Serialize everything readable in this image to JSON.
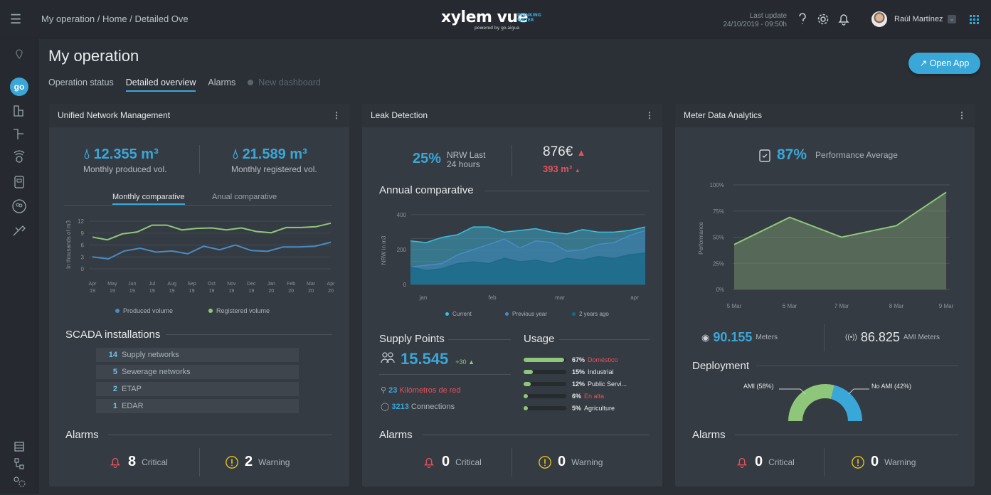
{
  "header": {
    "breadcrumb": "My operation / Home / Detailed Ove",
    "logo_main": "xylem vue",
    "logo_powered": "powered by go.aigua",
    "logo_tag1": "DRINKING",
    "logo_tag2": "WATER",
    "last_update_label": "Last update",
    "last_update_value": "24/10/2019 - 09:50h",
    "user_name": "Raúl Martínez"
  },
  "page": {
    "title": "My operation",
    "tabs": [
      "Operation status",
      "Detailed overview",
      "Alarms",
      "New dashboard"
    ],
    "open_app": "Open App"
  },
  "unm": {
    "title": "Unified Network Management",
    "produced_value": "12.355 m³",
    "produced_label": "Monthly produced vol.",
    "registered_value": "21.589 m³",
    "registered_label": "Monthly registered vol.",
    "tab_monthly": "Monthly comparative",
    "tab_annual": "Anual comparative",
    "ylabel": "In thousands of m3",
    "legend_produced": "Produced volume",
    "legend_registered": "Registered volume",
    "scada_title": "SCADA installations",
    "scada": [
      {
        "count": "14",
        "label": "Supply networks"
      },
      {
        "count": "5",
        "label": "Sewerage networks"
      },
      {
        "count": "2",
        "label": "ETAP"
      },
      {
        "count": "1",
        "label": "EDAR"
      }
    ],
    "alarms_title": "Alarms",
    "critical_count": "8",
    "critical_label": "Critical",
    "warning_count": "2",
    "warning_label": "Warning"
  },
  "leak": {
    "title": "Leak Detection",
    "nrw_pct": "25%",
    "nrw_label1": "NRW Last",
    "nrw_label2": "24 hours",
    "cost": "876€",
    "volume": "393 m³",
    "annual_title": "Annual comparative",
    "ylabel": "NRW in m3",
    "legend_current": "Current",
    "legend_prev": "Previous year",
    "legend_2y": "2 years ago",
    "supply_title": "Supply Points",
    "supply_value": "15.545",
    "supply_delta": "+30",
    "km_value": "23",
    "km_label": "Kilómetros de red",
    "conn_value": "3213",
    "conn_label": "Connections",
    "usage_title": "Usage",
    "usage": [
      {
        "pct": "67%",
        "label": "Doméstico",
        "fill": 0.67,
        "red": true
      },
      {
        "pct": "15%",
        "label": "Industrial",
        "fill": 0.15,
        "red": false
      },
      {
        "pct": "12%",
        "label": "Public Servi...",
        "fill": 0.12,
        "red": false
      },
      {
        "pct": "6%",
        "label": "En alta",
        "fill": 0.06,
        "red": true
      },
      {
        "pct": "5%",
        "label": "Agriculture",
        "fill": 0.05,
        "red": false
      }
    ],
    "alarms_title": "Alarms",
    "critical_count": "0",
    "critical_label": "Critical",
    "warning_count": "0",
    "warning_label": "Warning"
  },
  "mda": {
    "title": "Meter Data Analytics",
    "perf_value": "87%",
    "perf_label": "Performance Average",
    "ylabel": "Performance",
    "meters_value": "90.155",
    "meters_label": "Meters",
    "ami_value": "86.825",
    "ami_label": "AMI Meters",
    "deploy_title": "Deployment",
    "ami_pct_label": "AMI (58%)",
    "noami_pct_label": "No AMI (42%)",
    "ami_fraction": 0.58,
    "alarms_title": "Alarms",
    "critical_count": "0",
    "critical_label": "Critical",
    "warning_count": "0",
    "warning_label": "Warning"
  },
  "colors": {
    "accent": "#3aa7d9",
    "green": "#8fc77a",
    "blue": "#4a8bc4",
    "red": "#e8505b",
    "yellow": "#e8c21a"
  },
  "chart_data": [
    {
      "type": "line",
      "x": [
        "Apr 19",
        "May 19",
        "Jun 19",
        "Jul 19",
        "Aug 19",
        "Sep 19",
        "Oct 19",
        "Nov 19",
        "Dec 19",
        "Jan 20",
        "Feb 20",
        "Mar 20",
        "Apr 20"
      ],
      "series": [
        {
          "name": "Produced volume",
          "values": [
            3,
            2.5,
            4.5,
            5.2,
            4.2,
            4.5,
            3.8,
            5.7,
            4.8,
            6,
            4.6,
            4.4,
            5.5,
            5.5,
            5.7,
            6.7
          ]
        },
        {
          "name": "Registered volume",
          "values": [
            8,
            7.3,
            8.8,
            9.3,
            11,
            11,
            9.8,
            10.2,
            10.3,
            9.8,
            10.3,
            9.4,
            9.1,
            10.4,
            10.4,
            10.6,
            11.5
          ]
        }
      ],
      "ylabel": "In thousands of m3",
      "yticks": [
        0,
        3,
        6,
        9,
        12
      ],
      "ylim": [
        0,
        12
      ]
    },
    {
      "type": "area",
      "x": [
        "jan",
        "feb",
        "mar",
        "apr"
      ],
      "series": [
        {
          "name": "Current",
          "values": [
            250,
            240,
            270,
            285,
            330,
            330,
            300,
            310,
            320,
            300,
            290,
            315,
            300,
            300,
            310,
            330
          ]
        },
        {
          "name": "Previous year",
          "values": [
            100,
            110,
            120,
            170,
            200,
            230,
            260,
            210,
            250,
            240,
            190,
            200,
            230,
            240,
            280,
            310
          ]
        },
        {
          "name": "2 years ago",
          "values": [
            100,
            80,
            90,
            120,
            130,
            120,
            150,
            130,
            140,
            120,
            150,
            140,
            160,
            150,
            170,
            180
          ]
        }
      ],
      "ylabel": "NRW in m3",
      "yticks": [
        0,
        200,
        400
      ],
      "ylim": [
        0,
        420
      ]
    },
    {
      "type": "area",
      "x": [
        "5 Mar",
        "6 Mar",
        "7 Mar",
        "8 Mar",
        "9 Mar"
      ],
      "series": [
        {
          "values": [
            43,
            69,
            50,
            61,
            93
          ]
        }
      ],
      "ylabel": "Performance",
      "yticks": [
        "0%",
        "25%",
        "50%",
        "75%",
        "100%"
      ],
      "ylim": [
        0,
        100
      ]
    }
  ]
}
